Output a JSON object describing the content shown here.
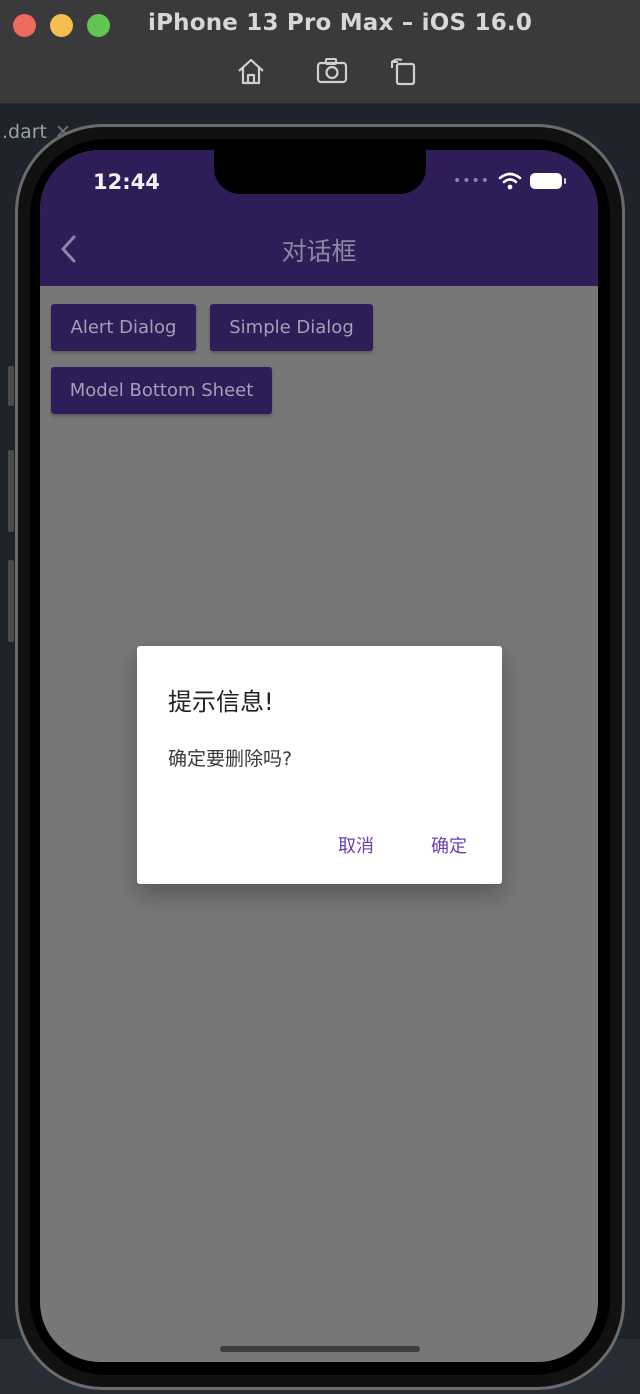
{
  "simulator": {
    "title": "iPhone 13 Pro Max – iOS 16.0",
    "tools": [
      "home-icon",
      "screenshot-icon",
      "rotate-icon"
    ]
  },
  "ide": {
    "tab_label": ".dart"
  },
  "status_bar": {
    "time": "12:44"
  },
  "app_bar": {
    "title": "对话框"
  },
  "buttons": {
    "alert": "Alert Dialog",
    "simple": "Simple Dialog",
    "sheet": "Model Bottom Sheet"
  },
  "dialog": {
    "title": "提示信息!",
    "content": "确定要删除吗?",
    "cancel": "取消",
    "ok": "确定"
  },
  "colors": {
    "app_bar": "#2e1d57",
    "scrim": "#777777",
    "accent": "#6b3fb2"
  }
}
